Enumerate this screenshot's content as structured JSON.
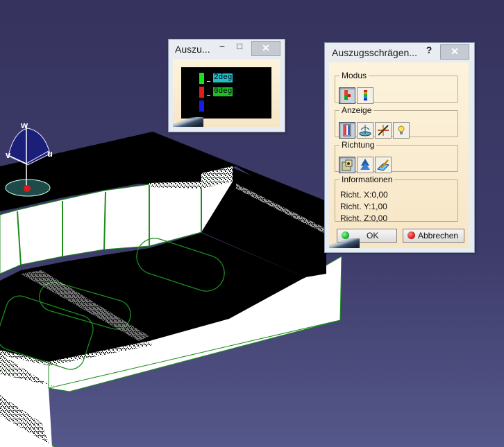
{
  "legend_window": {
    "title": "Auszu...",
    "minimize_glyph": "−",
    "maximize_glyph": "□",
    "close_glyph": "✕",
    "entries": [
      {
        "color": "#19e219",
        "label": "2deg",
        "label_bg": "#20c0c0"
      },
      {
        "color": "#e11d1d",
        "label": "0deg",
        "label_bg": "#1fbf1f"
      },
      {
        "color": "#1b1be8",
        "label": ""
      }
    ]
  },
  "draft_dialog": {
    "title": "Auszugsschrägen...",
    "help_glyph": "?",
    "close_glyph": "✕",
    "modus": {
      "label": "Modus",
      "buttons": [
        "draft-color-mode-icon",
        "draft-gradient-mode-icon"
      ]
    },
    "anzeige": {
      "label": "Anzeige",
      "buttons": [
        "cursor-display-icon",
        "compass-display-icon",
        "cross-display-icon",
        "light-bulb-icon"
      ]
    },
    "richtung": {
      "label": "Richtung",
      "buttons": [
        "lock-direction-icon",
        "compass-direction-icon",
        "edit-direction-icon"
      ]
    },
    "informationen": {
      "label": "Informationen",
      "lines": [
        "Richt. X:0,00",
        "Richt. Y:1,00",
        "Richt. Z:0,00"
      ]
    },
    "ok_label": "OK",
    "cancel_label": "Abbrechen"
  },
  "compass": {
    "labels": {
      "w": "w",
      "v": "v",
      "u": "u"
    }
  },
  "colors": {
    "background_top": "#36345e",
    "background_bottom": "#55588a",
    "model_face": "#000000",
    "model_wall": "#ffffff",
    "model_edge": "#1e8c1e",
    "ok_indicator": "#1fae3a",
    "cancel_indicator": "#d22020"
  }
}
